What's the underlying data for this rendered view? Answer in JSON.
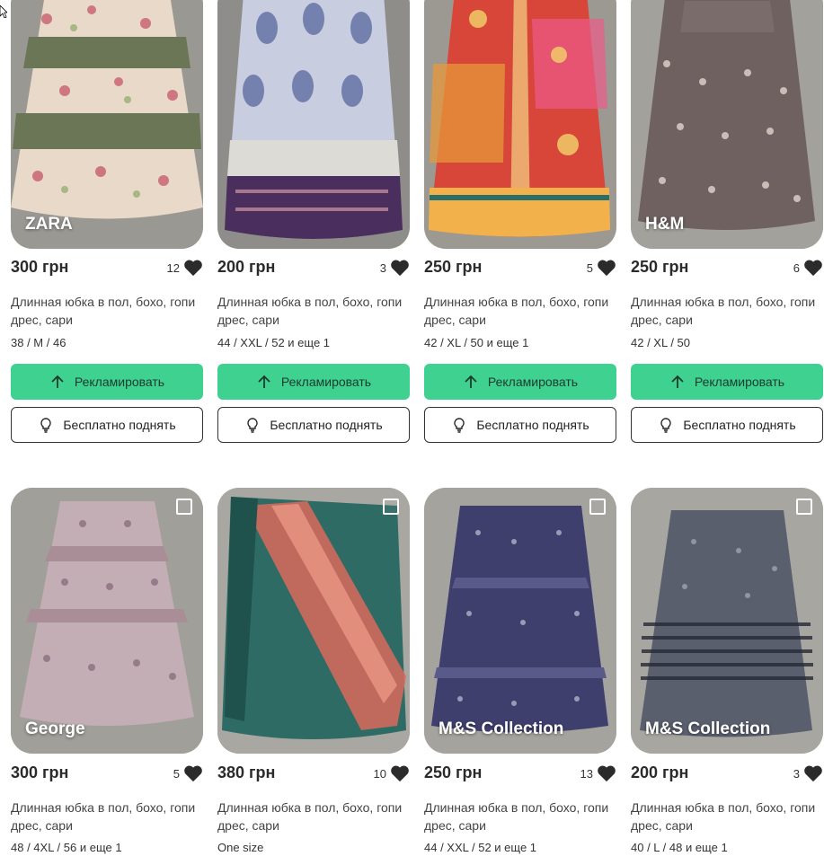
{
  "listings": [
    {
      "brand": "ZARA",
      "price": "300 грн",
      "likes": "12",
      "title": "Длинная юбка в пол, бохо, гопи дрес, сари",
      "sizes": "38 / M / 46",
      "promote_label": "Рекламировать",
      "free_boost_label": "Бесплатно поднять"
    },
    {
      "brand": "",
      "price": "200 грн",
      "likes": "3",
      "title": "Длинная юбка в пол, бохо, гопи дрес, сари",
      "sizes": "44 / XXL / 52 и еще 1",
      "promote_label": "Рекламировать",
      "free_boost_label": "Бесплатно поднять"
    },
    {
      "brand": "",
      "price": "250 грн",
      "likes": "5",
      "title": "Длинная юбка в пол, бохо, гопи дрес, сари",
      "sizes": "42 / XL / 50 и еще 1",
      "promote_label": "Рекламировать",
      "free_boost_label": "Бесплатно поднять"
    },
    {
      "brand": "H&M",
      "price": "250 грн",
      "likes": "6",
      "title": "Длинная юбка в пол, бохо, гопи дрес, сари",
      "sizes": "42 / XL / 50",
      "promote_label": "Рекламировать",
      "free_boost_label": "Бесплатно поднять"
    },
    {
      "brand": "George",
      "price": "300 грн",
      "likes": "5",
      "title": "Длинная юбка в пол, бохо, гопи дрес, сари",
      "sizes": "48 / 4XL / 56 и еще 1"
    },
    {
      "brand": "",
      "price": "380 грн",
      "likes": "10",
      "title": "Длинная юбка в пол, бохо, гопи дрес, сари",
      "sizes": "One size"
    },
    {
      "brand": "M&S Collection",
      "price": "250 грн",
      "likes": "13",
      "title": "Длинная юбка в пол, бохо, гопи дрес, сари",
      "sizes": "44 / XXL / 52 и еще 1"
    },
    {
      "brand": "M&S Collection",
      "price": "200 грн",
      "likes": "3",
      "title": "Длинная юбка в пол, бохо, гопи дрес, сари",
      "sizes": "40 / L / 48 и еще 1"
    }
  ],
  "colors": {
    "promote_bg": "#3fd18f",
    "border": "#333333",
    "heart": "#2b2b2b"
  },
  "icons": {
    "like": "heart-icon",
    "promote": "arrow-up-icon",
    "free_boost": "lightbulb-icon",
    "select": "checkbox-icon"
  }
}
